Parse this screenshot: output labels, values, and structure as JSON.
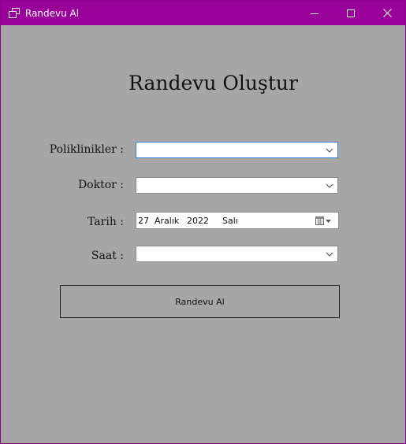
{
  "window": {
    "title": "Randevu Al",
    "controls": [
      "minimize-icon",
      "maximize-icon",
      "close-icon"
    ],
    "titlebar_color": "#9a009a",
    "background_color": "#a6a6a6"
  },
  "form": {
    "heading": "Randevu Oluştur",
    "polyclinics_label": "Poliklinikler :",
    "polyclinics_value": "",
    "doctor_label": "Doktor :",
    "doctor_value": "",
    "date_label": "Tarih :",
    "date": {
      "day": "27",
      "month": "Aralık",
      "year": "2022",
      "weekday": "Salı"
    },
    "time_label": "Saat :",
    "time_value": "",
    "submit_label": "Randevu Al"
  }
}
